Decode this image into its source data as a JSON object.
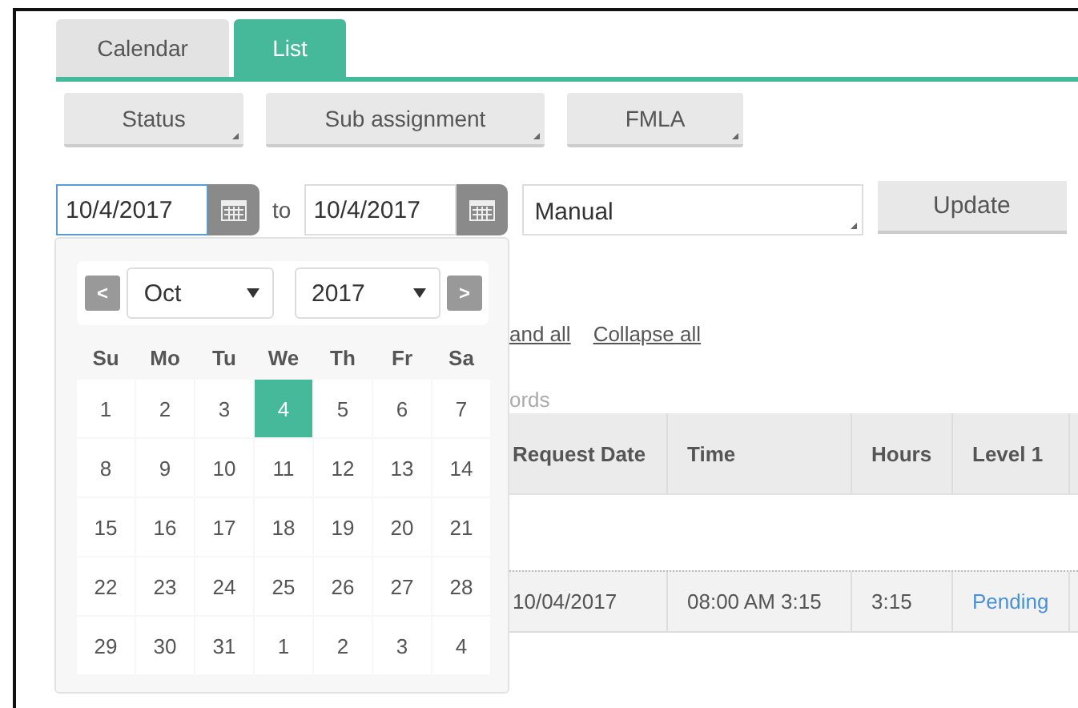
{
  "tabs": [
    {
      "label": "Calendar",
      "selected": false
    },
    {
      "label": "List",
      "selected": true
    }
  ],
  "filters": [
    "Status",
    "Sub assignment",
    "FMLA"
  ],
  "date_from": {
    "value": "10/4/2017",
    "focused": true
  },
  "to_label": "to",
  "date_to": {
    "value": "10/4/2017",
    "focused": false
  },
  "mode_select": {
    "value": "Manual"
  },
  "update_button": "Update",
  "links": [
    "and all",
    "Collapse all"
  ],
  "records_text": "ords",
  "table": {
    "columns": [
      "Request Date",
      "Time",
      "Hours",
      "Level 1"
    ],
    "rows": [
      {
        "cells": [
          "10/04/2017",
          "08:00 AM 3:15",
          "3:15"
        ],
        "status": "Pending"
      }
    ]
  },
  "datepicker": {
    "prev": "<",
    "next": ">",
    "month": "Oct",
    "year": "2017",
    "weekdays": [
      "Su",
      "Mo",
      "Tu",
      "We",
      "Th",
      "Fr",
      "Sa"
    ],
    "weeks": [
      [
        {
          "day": "1",
          "selected": false
        },
        {
          "day": "2",
          "selected": false
        },
        {
          "day": "3",
          "selected": false
        },
        {
          "day": "4",
          "selected": true
        },
        {
          "day": "5",
          "selected": false
        },
        {
          "day": "6",
          "selected": false
        },
        {
          "day": "7",
          "selected": false
        }
      ],
      [
        {
          "day": "8",
          "selected": false
        },
        {
          "day": "9",
          "selected": false
        },
        {
          "day": "10",
          "selected": false
        },
        {
          "day": "11",
          "selected": false
        },
        {
          "day": "12",
          "selected": false
        },
        {
          "day": "13",
          "selected": false
        },
        {
          "day": "14",
          "selected": false
        }
      ],
      [
        {
          "day": "15",
          "selected": false
        },
        {
          "day": "16",
          "selected": false
        },
        {
          "day": "17",
          "selected": false
        },
        {
          "day": "18",
          "selected": false
        },
        {
          "day": "19",
          "selected": false
        },
        {
          "day": "20",
          "selected": false
        },
        {
          "day": "21",
          "selected": false
        }
      ],
      [
        {
          "day": "22",
          "selected": false
        },
        {
          "day": "23",
          "selected": false
        },
        {
          "day": "24",
          "selected": false
        },
        {
          "day": "25",
          "selected": false
        },
        {
          "day": "26",
          "selected": false
        },
        {
          "day": "27",
          "selected": false
        },
        {
          "day": "28",
          "selected": false
        }
      ],
      [
        {
          "day": "29",
          "selected": false
        },
        {
          "day": "30",
          "selected": false
        },
        {
          "day": "31",
          "selected": false
        },
        {
          "day": "1",
          "selected": false
        },
        {
          "day": "2",
          "selected": false
        },
        {
          "day": "3",
          "selected": false
        },
        {
          "day": "4",
          "selected": false
        }
      ]
    ]
  }
}
